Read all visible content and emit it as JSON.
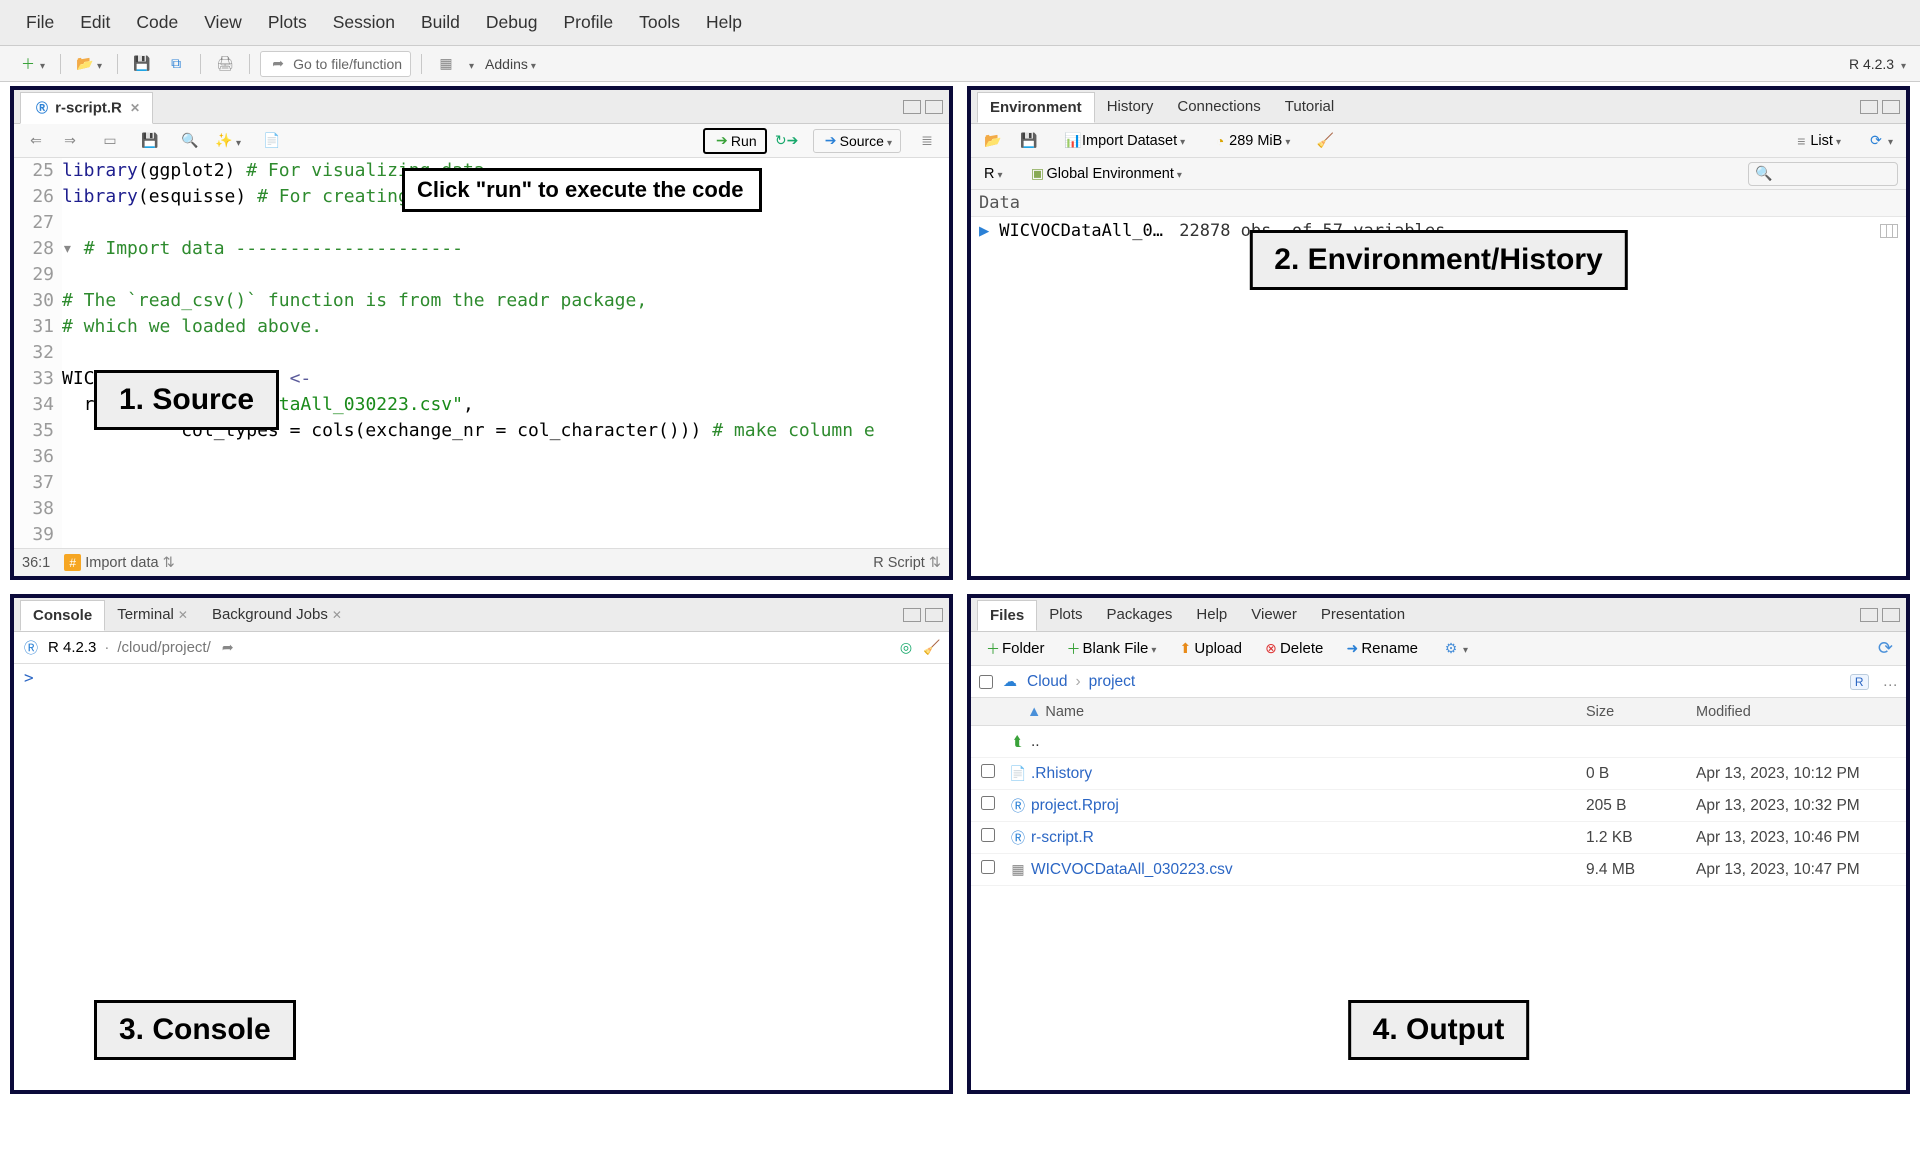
{
  "menubar": [
    "File",
    "Edit",
    "Code",
    "View",
    "Plots",
    "Session",
    "Build",
    "Debug",
    "Profile",
    "Tools",
    "Help"
  ],
  "toolbar": {
    "goto_placeholder": "Go to file/function",
    "addins_label": "Addins",
    "r_version": "R 4.2.3"
  },
  "source": {
    "tab_name": "r-script.R",
    "run_label": "Run",
    "source_label": "Source",
    "lines": [
      {
        "n": 25,
        "code": [
          {
            "t": "library",
            "c": "kw-fn"
          },
          {
            "t": "(ggplot2) "
          },
          {
            "t": "# For visualizing data",
            "c": "kw-comment"
          }
        ]
      },
      {
        "n": 26,
        "code": [
          {
            "t": "library",
            "c": "kw-fn"
          },
          {
            "t": "(esquisse) "
          },
          {
            "t": "# For creating visualizations interactively",
            "c": "kw-comment"
          }
        ]
      },
      {
        "n": 27,
        "code": [
          {
            "t": ""
          }
        ]
      },
      {
        "n": 28,
        "code": [
          {
            "t": "# Import data ---------------------",
            "c": "kw-comment"
          }
        ],
        "fold": true
      },
      {
        "n": 29,
        "code": [
          {
            "t": ""
          }
        ]
      },
      {
        "n": 30,
        "code": [
          {
            "t": "# The `read_csv()` function is from the readr package,",
            "c": "kw-comment"
          }
        ]
      },
      {
        "n": 31,
        "code": [
          {
            "t": "# which we loaded above.",
            "c": "kw-comment"
          }
        ]
      },
      {
        "n": 32,
        "code": [
          {
            "t": ""
          }
        ]
      },
      {
        "n": 33,
        "code": [
          {
            "t": "WICVOCDataAll_030223 "
          },
          {
            "t": "<-",
            "c": "kw-op"
          }
        ]
      },
      {
        "n": 34,
        "code": [
          {
            "t": "  read_csv("
          },
          {
            "t": "\"WICVOCDataAll_030223.csv\"",
            "c": "kw-str"
          },
          {
            "t": ","
          }
        ]
      },
      {
        "n": 35,
        "code": [
          {
            "t": "           col_types = cols(exchange_nr = col_character())) "
          },
          {
            "t": "# make column e",
            "c": "kw-comment"
          }
        ]
      },
      {
        "n": 36,
        "code": [
          {
            "t": ""
          }
        ]
      },
      {
        "n": 37,
        "code": [
          {
            "t": ""
          }
        ]
      },
      {
        "n": 38,
        "code": [
          {
            "t": ""
          }
        ]
      },
      {
        "n": 39,
        "code": [
          {
            "t": ""
          }
        ]
      }
    ],
    "status_left": "36:1",
    "status_section": "Import data",
    "status_right": "R Script",
    "annot_source": "1. Source",
    "annot_run": "Click \"run\" to execute the code"
  },
  "console": {
    "tabs": [
      "Console",
      "Terminal",
      "Background Jobs"
    ],
    "r_version": "R 4.2.3",
    "path": "/cloud/project/",
    "prompt": ">",
    "annot": "3. Console"
  },
  "environment": {
    "tabs": [
      "Environment",
      "History",
      "Connections",
      "Tutorial"
    ],
    "import_label": "Import Dataset",
    "mem": "289 MiB",
    "view_mode": "List",
    "scope_lang": "R",
    "scope_env": "Global Environment",
    "section": "Data",
    "item_name": "WICVOCDataAll_03…",
    "item_desc": "22878 obs. of 57 variables",
    "annot": "2. Environment/History"
  },
  "files": {
    "tabs": [
      "Files",
      "Plots",
      "Packages",
      "Help",
      "Viewer",
      "Presentation"
    ],
    "toolbar": {
      "folder": "Folder",
      "blank": "Blank File",
      "upload": "Upload",
      "delete": "Delete",
      "rename": "Rename"
    },
    "crumb1": "Cloud",
    "crumb2": "project",
    "headers": {
      "name": "Name",
      "size": "Size",
      "modified": "Modified"
    },
    "up_label": "..",
    "rows": [
      {
        "icon": "hist",
        "name": ".Rhistory",
        "size": "0 B",
        "mod": "Apr 13, 2023, 10:12 PM"
      },
      {
        "icon": "rproj",
        "name": "project.Rproj",
        "size": "205 B",
        "mod": "Apr 13, 2023, 10:32 PM"
      },
      {
        "icon": "rscr",
        "name": "r-script.R",
        "size": "1.2 KB",
        "mod": "Apr 13, 2023, 10:46 PM"
      },
      {
        "icon": "csv",
        "name": "WICVOCDataAll_030223.csv",
        "size": "9.4 MB",
        "mod": "Apr 13, 2023, 10:47 PM"
      }
    ],
    "annot": "4. Output"
  }
}
